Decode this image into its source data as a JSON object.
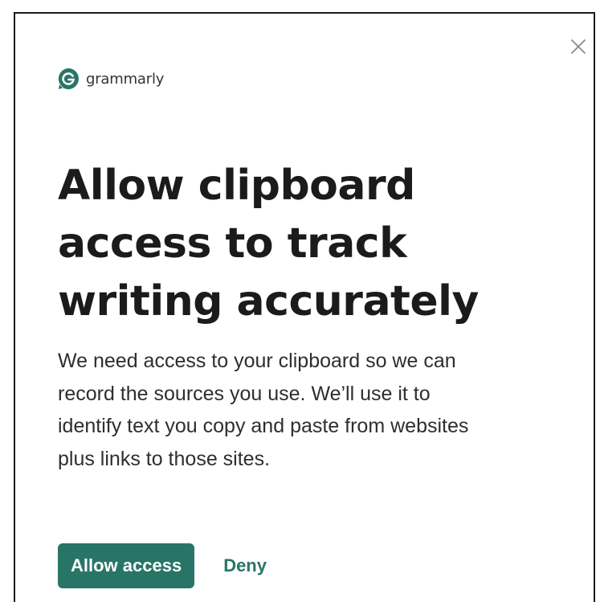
{
  "brand": {
    "name": "grammarly",
    "logo_icon": "grammarly-g-icon",
    "logo_color": "#287567"
  },
  "dialog": {
    "close_icon": "close-icon",
    "headline_lines": [
      "Allow clipboard",
      "access to track",
      "writing accurately"
    ],
    "body_lines": [
      "We need access to your clipboard so we can",
      "record the sources you use. We’ll use it to",
      "identify text you copy and paste from websites",
      "plus links to those sites."
    ]
  },
  "actions": {
    "allow_label": "Allow access",
    "deny_label": "Deny",
    "accent_color": "#287567"
  }
}
